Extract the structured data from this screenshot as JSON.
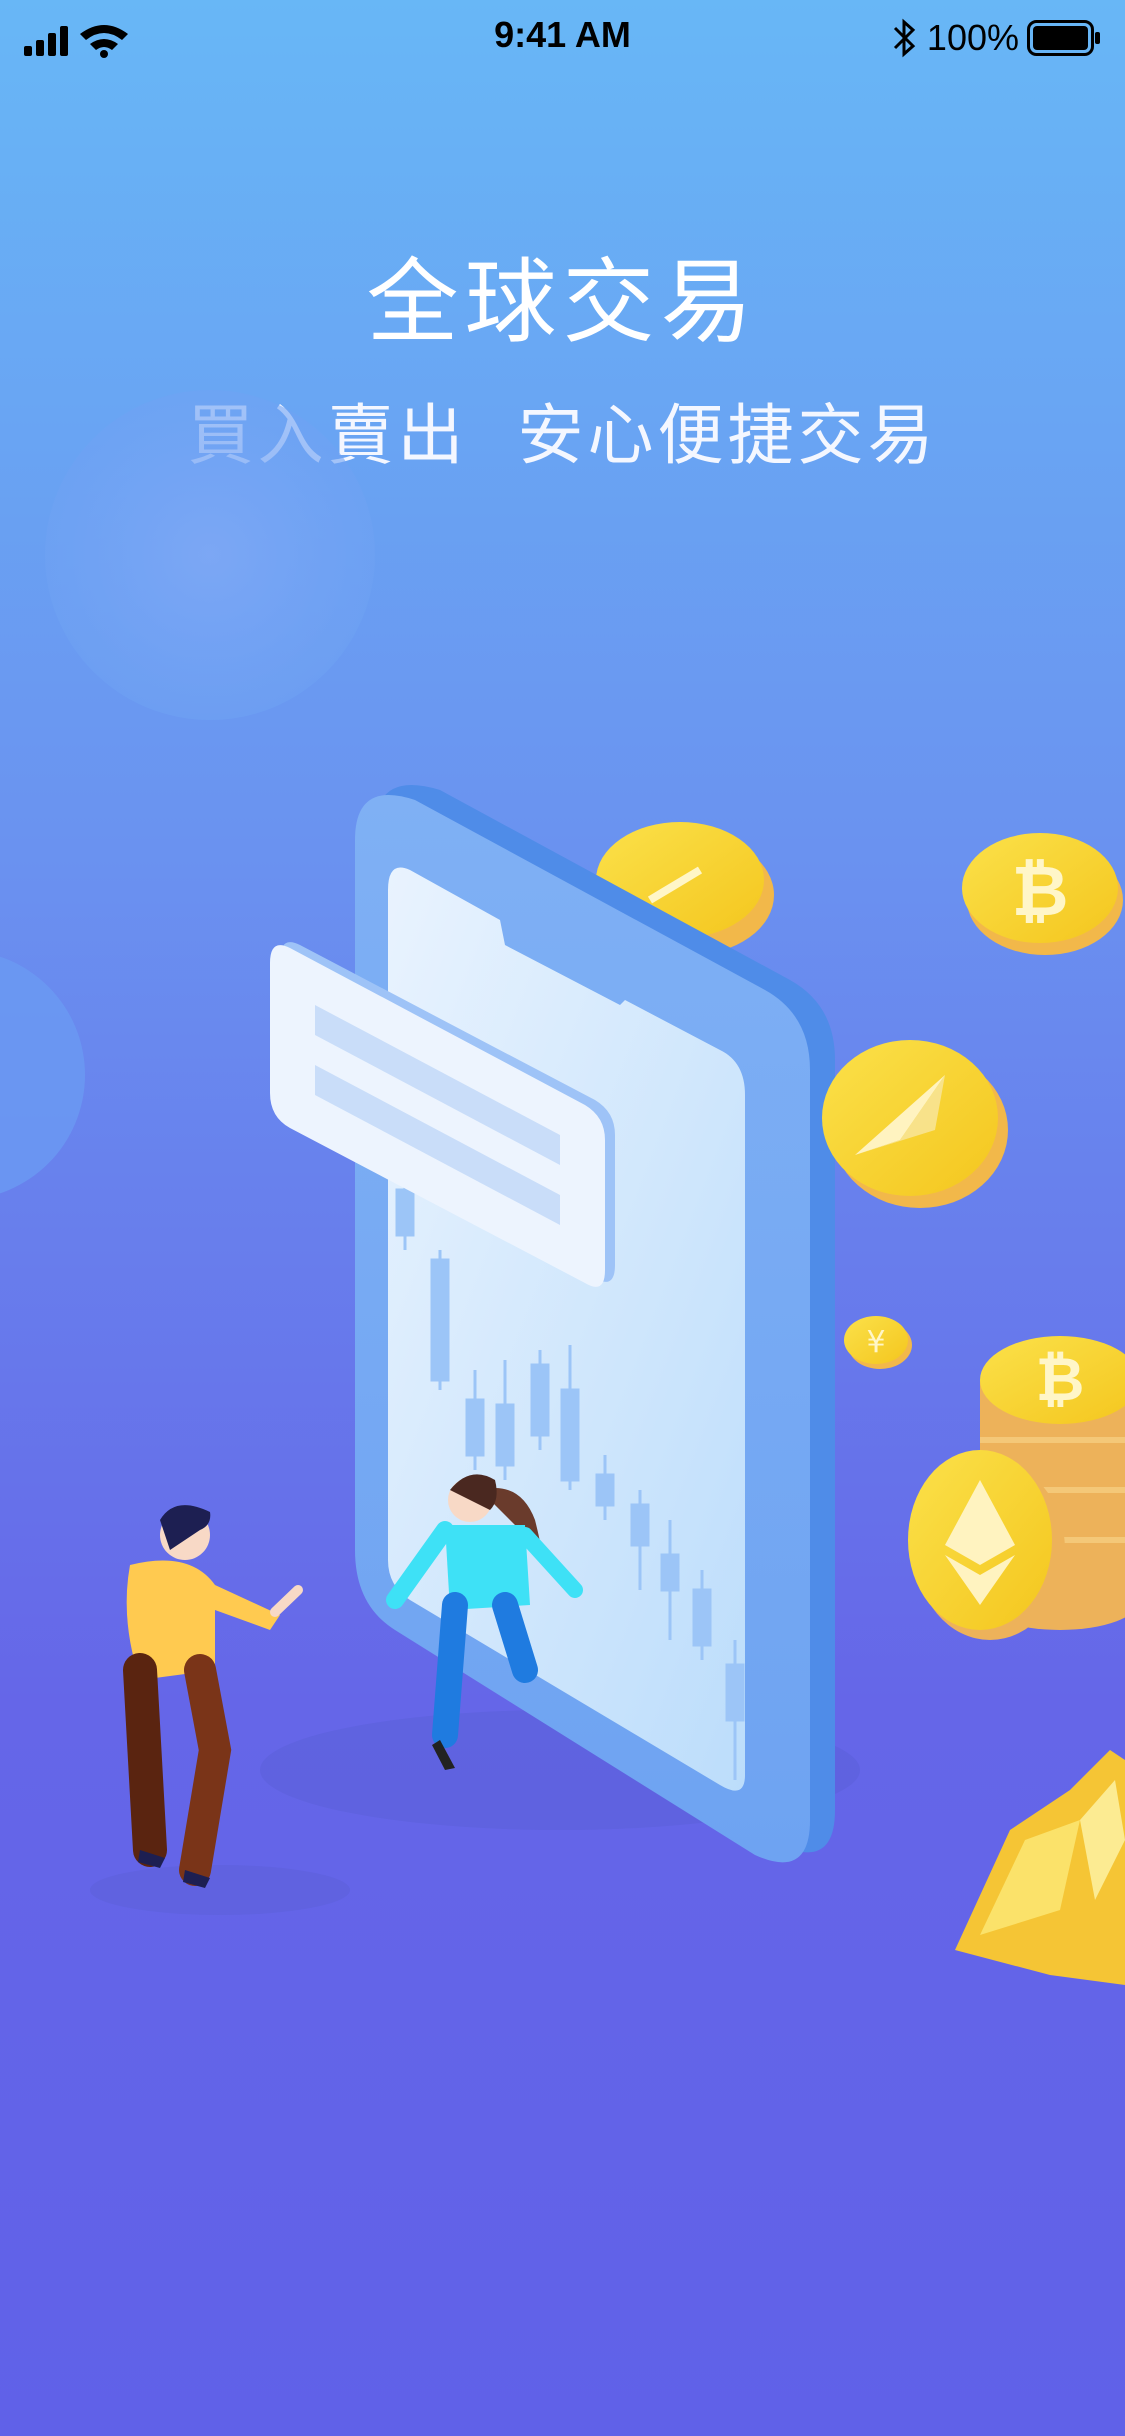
{
  "status_bar": {
    "time": "9:41 AM",
    "battery_percent": "100%",
    "icons": [
      "cellular-signal-icon",
      "wifi-icon",
      "bluetooth-icon",
      "battery-icon"
    ]
  },
  "onboarding": {
    "title": "全球交易",
    "subtitle": "買入賣出  安心便捷交易"
  },
  "colors": {
    "background_top": "#68B7F6",
    "background_bottom": "#6061E8",
    "text": "#FFFFFF",
    "coin_gold": "#F5D02A"
  },
  "illustration": {
    "icons": [
      "phone-icon",
      "candlestick-chart-icon",
      "message-card-icon",
      "bitcoin-coin-icon",
      "ethereum-coin-icon",
      "yen-coin-icon",
      "gold-nuggets-icon",
      "man-figure-icon",
      "woman-figure-icon"
    ]
  }
}
